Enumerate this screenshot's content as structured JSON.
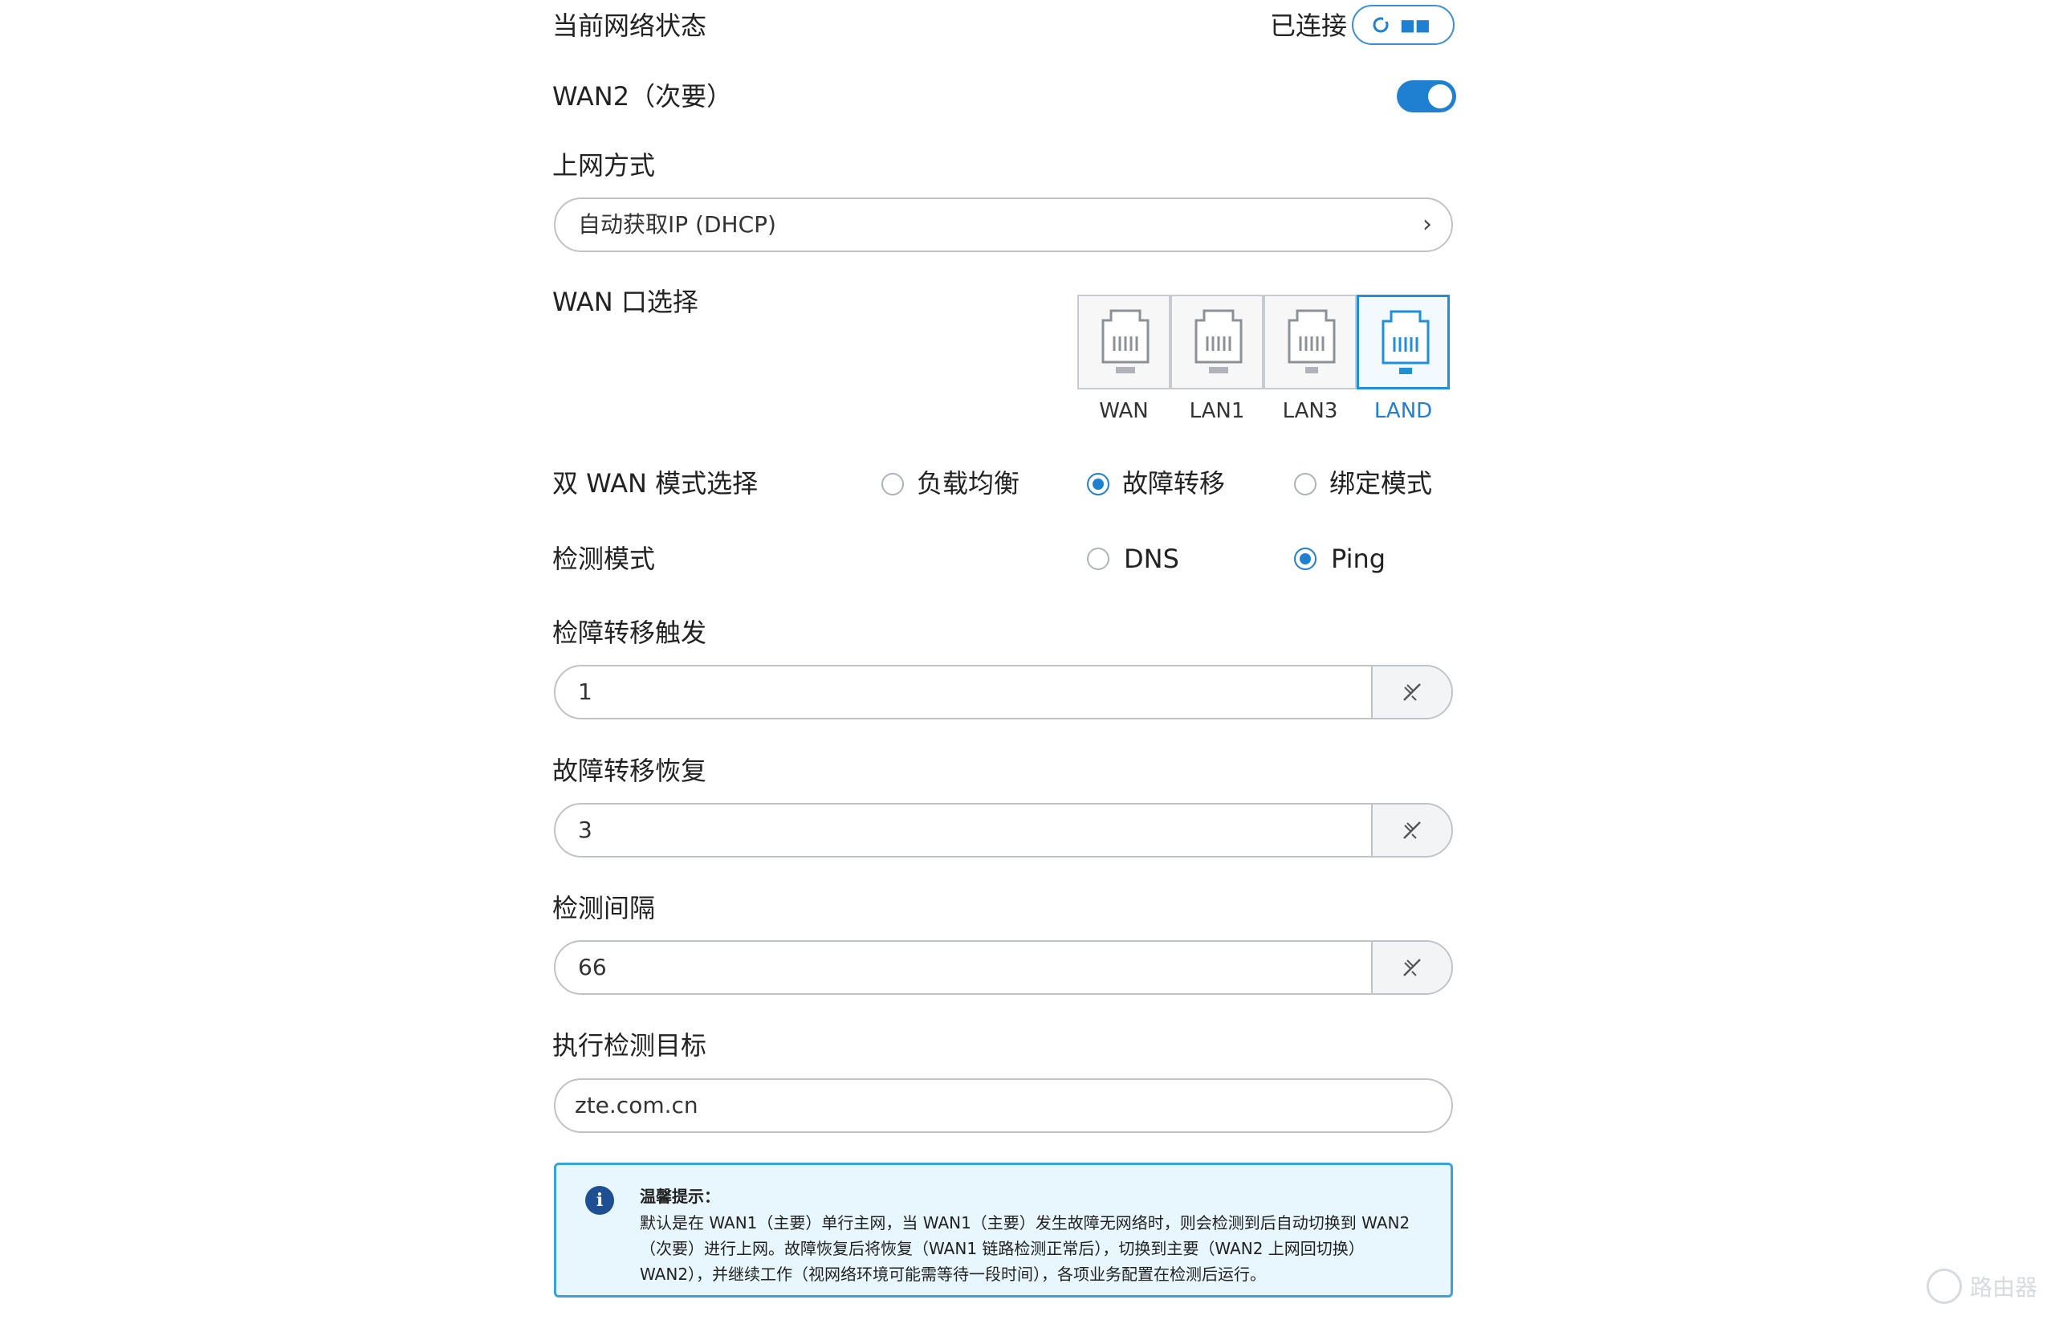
{
  "status": {
    "label": "当前网络状态",
    "value": "已连接",
    "chip_text": "■■"
  },
  "wan2": {
    "label": "WAN2（次要）",
    "enabled": true
  },
  "connection_type": {
    "label": "上网方式",
    "value": "自动获取IP (DHCP)"
  },
  "wan_port": {
    "label": "WAN 口选择",
    "ports": [
      {
        "label": "WAN",
        "selected": false
      },
      {
        "label": "LAN1",
        "selected": false
      },
      {
        "label": "LAN3",
        "selected": false
      },
      {
        "label": "LAND",
        "selected": true
      }
    ]
  },
  "dual_wan_mode": {
    "label": "双 WAN 模式选择",
    "options": [
      {
        "label": "负载均衡",
        "selected": false
      },
      {
        "label": "故障转移",
        "selected": true
      },
      {
        "label": "绑定模式",
        "selected": false
      }
    ]
  },
  "detect_mode": {
    "label": "检测模式",
    "options": [
      {
        "label": "DNS",
        "selected": false
      },
      {
        "label": "Ping",
        "selected": true
      }
    ]
  },
  "failover_trigger": {
    "label": "检障转移触发",
    "value": "1"
  },
  "failover_recovery": {
    "label": "故障转移恢复",
    "value": "3"
  },
  "detect_interval": {
    "label": "检测间隔",
    "value": "66"
  },
  "detect_target": {
    "label": "执行检测目标",
    "value": "zte.com.cn"
  },
  "notice": {
    "title": "温馨提示：",
    "body": "默认是在 WAN1（主要）单行主网，当 WAN1（主要）发生故障无网络时，则会检测到后自动切换到 WAN2（次要）进行上网。故障恢复后将恢复（WAN1 链路检测正常后），切换到主要（WAN2 上网回切换）WAN2），并继续工作（视网络环境可能需等待一段时间），各项业务配置在检测后运行。"
  },
  "watermark": "路由器",
  "colors": {
    "accent": "#1f7fd0",
    "notice_border": "#3aa3dc",
    "notice_bg": "#e8f6fd"
  }
}
